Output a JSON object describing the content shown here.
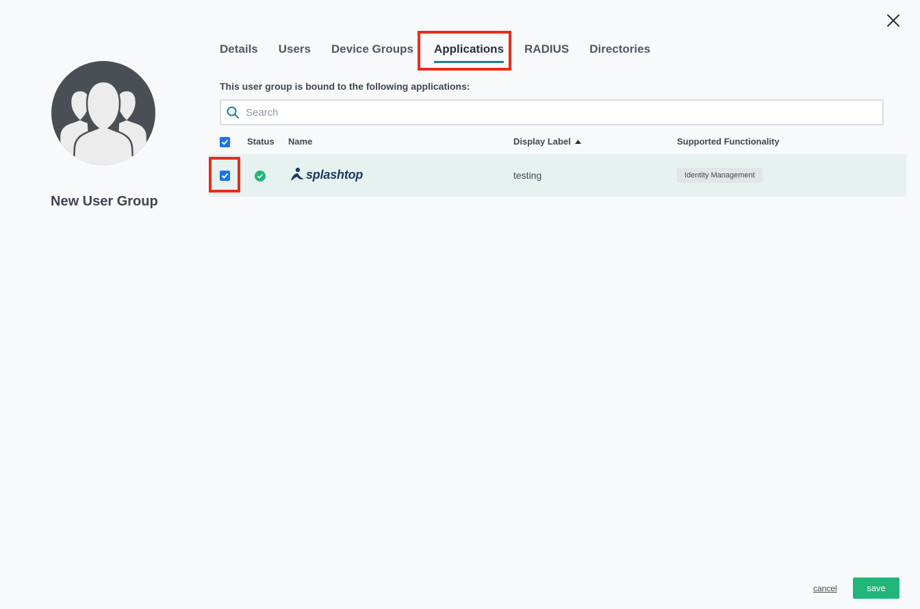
{
  "modal": {
    "close_icon": "close-icon"
  },
  "group": {
    "avatar_icon": "user-group-icon",
    "name": "New User Group"
  },
  "tabs": [
    {
      "label": "Details",
      "active": false
    },
    {
      "label": "Users",
      "active": false
    },
    {
      "label": "Device Groups",
      "active": false
    },
    {
      "label": "Applications",
      "active": true
    },
    {
      "label": "RADIUS",
      "active": false
    },
    {
      "label": "Directories",
      "active": false
    }
  ],
  "bound_text": "This user group is bound to the following applications:",
  "search": {
    "placeholder": "Search",
    "value": "",
    "icon": "search-icon"
  },
  "table": {
    "headers": {
      "status": "Status",
      "name": "Name",
      "display_label": "Display Label",
      "supported_functionality": "Supported Functionality"
    },
    "sort": {
      "column": "display_label",
      "direction": "ascending"
    },
    "select_all_checked": true,
    "rows": [
      {
        "checked": true,
        "status": "active",
        "status_icon": "check-circle-icon",
        "name": "splashtop",
        "display_label": "testing",
        "supported_functionality": "Identity Management"
      }
    ]
  },
  "footer": {
    "cancel_label": "cancel",
    "save_label": "save"
  },
  "colors": {
    "accent_teal": "#1c7f8a",
    "checkbox_blue": "#1a73e8",
    "status_green": "#22b57a",
    "save_green": "#22b57a",
    "highlight_red": "#ec2a18",
    "row_bg": "#e6f1f0"
  }
}
